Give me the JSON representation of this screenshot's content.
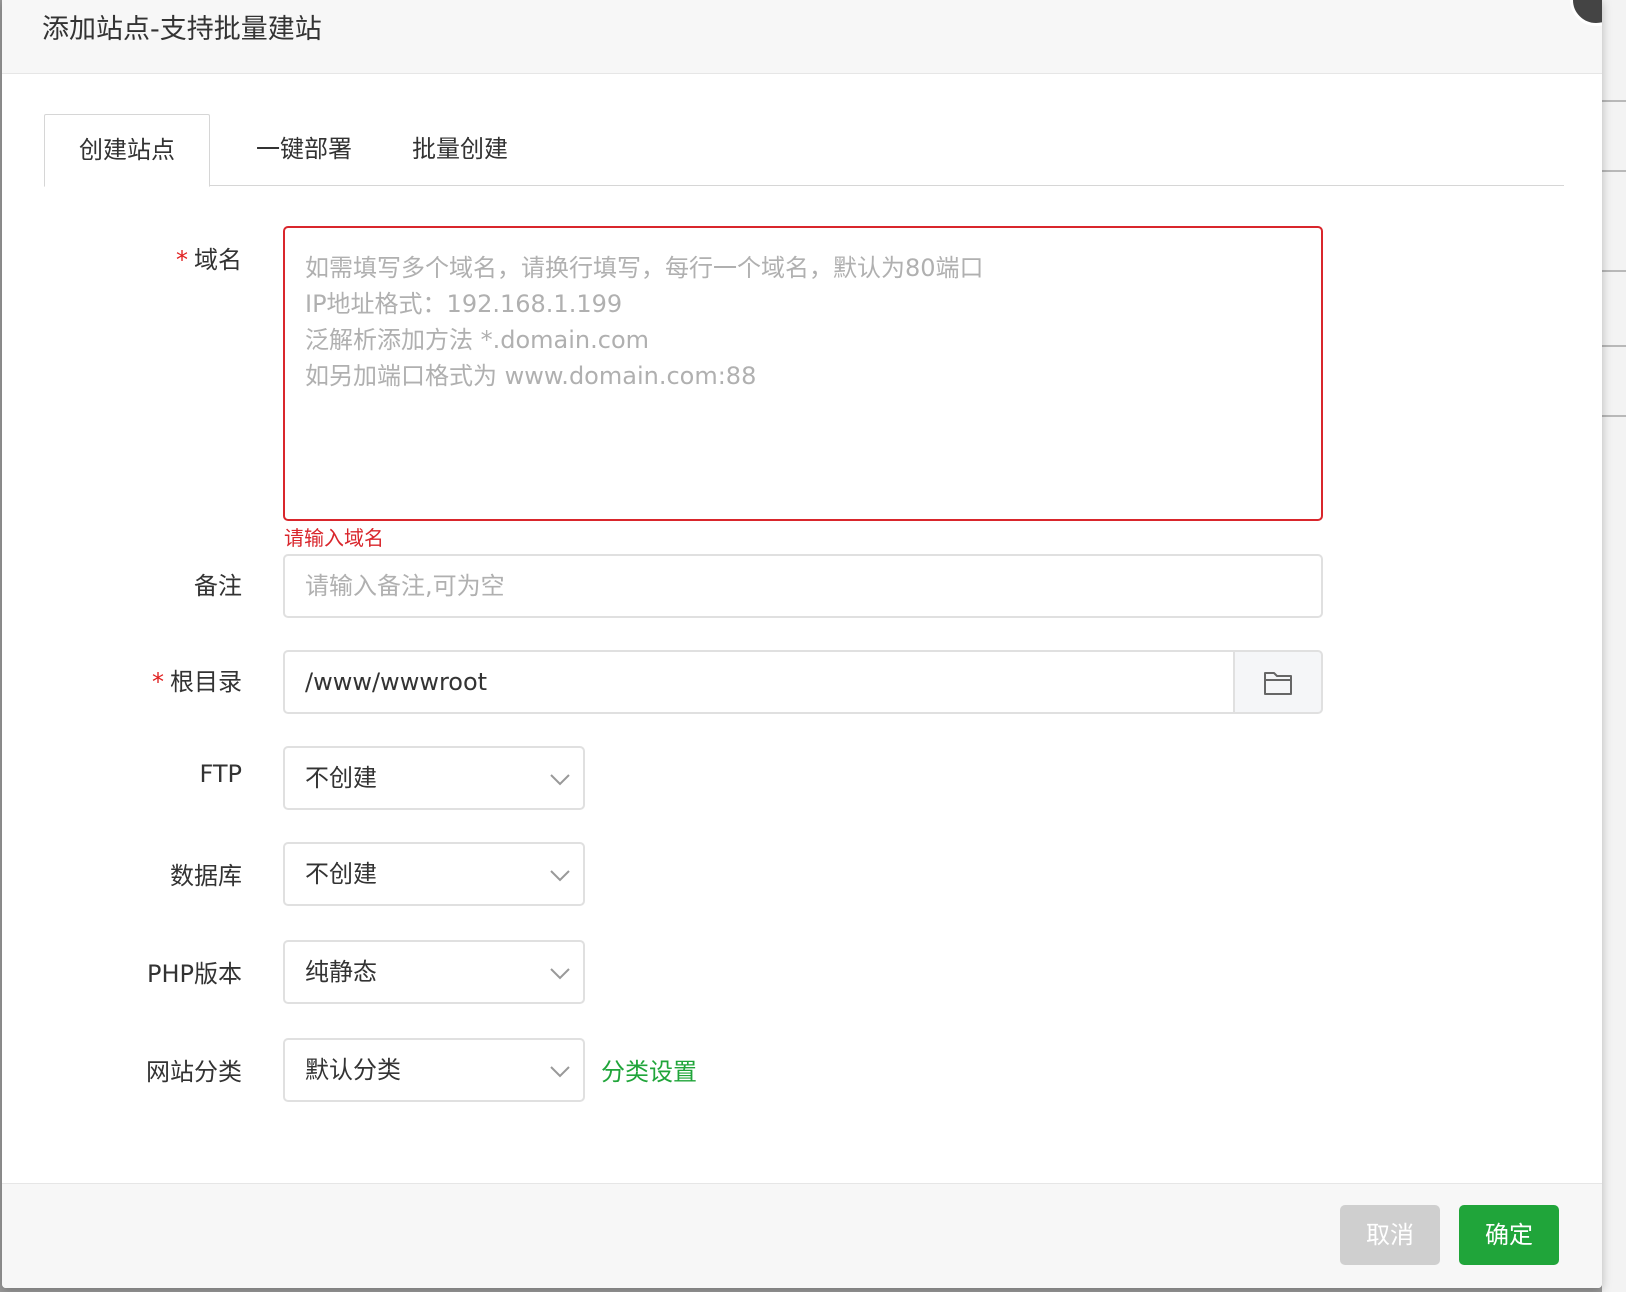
{
  "dialog": {
    "title": "添加站点-支持批量建站"
  },
  "tabs": [
    {
      "label": "创建站点",
      "active": true
    },
    {
      "label": "一键部署",
      "active": false
    },
    {
      "label": "批量创建",
      "active": false
    }
  ],
  "form": {
    "domain": {
      "required_mark": "*",
      "label": "域名",
      "placeholder": "如需填写多个域名，请换行填写，每行一个域名，默认为80端口\nIP地址格式：192.168.1.199\n泛解析添加方法 *.domain.com\n如另加端口格式为 www.domain.com:88",
      "error": "请输入域名"
    },
    "remark": {
      "label": "备注",
      "placeholder": "请输入备注,可为空"
    },
    "root": {
      "required_mark": "*",
      "label": "根目录",
      "value": "/www/wwwroot",
      "icon": "folder-icon"
    },
    "ftp": {
      "label": "FTP",
      "value": "不创建"
    },
    "database": {
      "label": "数据库",
      "value": "不创建"
    },
    "php": {
      "label": "PHP版本",
      "value": "纯静态"
    },
    "category": {
      "label": "网站分类",
      "value": "默认分类",
      "link": "分类设置"
    }
  },
  "footer": {
    "cancel_label": "取消",
    "confirm_label": "确定"
  },
  "colors": {
    "accent_green": "#20a53a",
    "error_red": "#d9262c"
  }
}
